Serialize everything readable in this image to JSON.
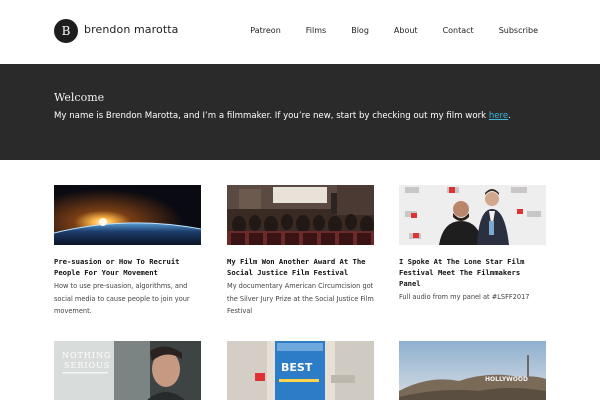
{
  "site": {
    "logo_letter": "B",
    "name": "brendon marotta"
  },
  "nav": {
    "items": [
      "Patreon",
      "Films",
      "Blog",
      "About",
      "Contact",
      "Subscribe"
    ]
  },
  "hero": {
    "title": "Welcome",
    "text_before": "My name is Brendon Marotta, and I’m a filmmaker. If you’re new, start by checking out my film work ",
    "link_text": "here",
    "text_after": "."
  },
  "posts": [
    {
      "title": "Pre-suasion or How To Recruit People For Your Movement",
      "excerpt": "How to use pre-suasion, algorithms, and social media to cause people to join your movement."
    },
    {
      "title": "My Film Won Another Award At The Social Justice Film Festival",
      "excerpt": "My documentary American Circumcision got the Silver Jury Prize at the Social Justice Film Festival"
    },
    {
      "title": "I Spoke At The Lone Star Film Festival Meet The Filmmakers Panel",
      "excerpt": "Full audio from my panel at #LSFF2017"
    },
    {
      "thumb_text_line1": "NOTHING",
      "thumb_text_line2": "SERIOUS"
    },
    {
      "thumb_text_line1": "BEST"
    },
    {
      "thumb_text_line1": "HOLLYWOOD"
    }
  ],
  "colors": {
    "hero_bg": "#2a2a2a",
    "link": "#3fb6d6"
  }
}
